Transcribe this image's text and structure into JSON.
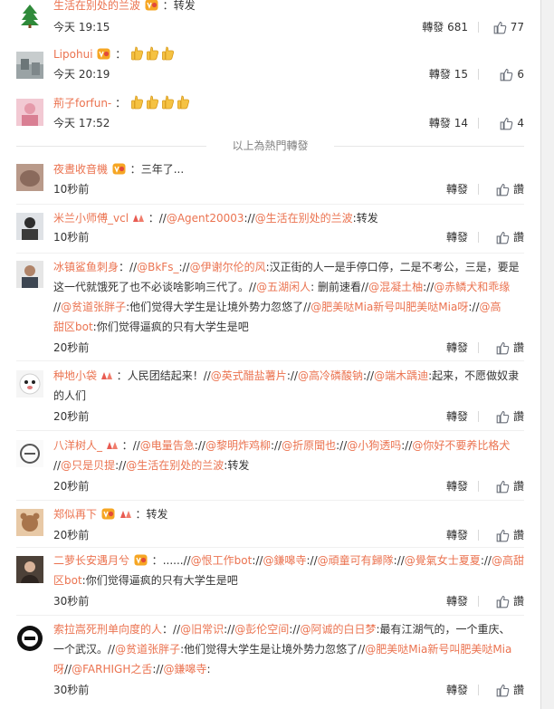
{
  "texts": {
    "popular_divider": "以上為熱門轉發",
    "retweet_label": "轉發",
    "like_label": "讚",
    "colon": "："
  },
  "colors": {
    "accent": "#eb7350",
    "text": "#333333",
    "muted": "#808080"
  },
  "icons": [
    "vip-badge-icon",
    "candle-flag-icon",
    "thumbs-up-emoji-icon",
    "like-icon"
  ],
  "popular": [
    {
      "name": "生活在别处的兰波",
      "text": "转发",
      "time": "今天 19:15",
      "retweets": "轉發 681",
      "likes": "77"
    },
    {
      "name": "Lipohui",
      "text": "",
      "thumbs": 3,
      "time": "今天 20:19",
      "retweets": "轉發 15",
      "likes": "6"
    },
    {
      "name": "荊子forfun-",
      "text": "",
      "thumbs": 4,
      "time": "今天 17:52",
      "retweets": "轉發 14",
      "likes": "4"
    }
  ],
  "recent": [
    {
      "name": "夜晝收音機",
      "line1": "三年了...",
      "time": "10秒前"
    },
    {
      "name": "米兰小师傅_vcl",
      "mentions": [
        "@Agent20003",
        "@生活在别处的兰波"
      ],
      "tail": "转发",
      "time": "10秒前"
    },
    {
      "name": "冰镇鲨鱼刺身",
      "m1": "@BkFs_",
      "m2": "@伊谢尔伦的风",
      "t2": "汉正街的人一是手停口停，二是不考公，三是，要是",
      "t3": "这一代就饿死了也不必谈啥影响三代了。",
      "m3": "@五湖闲人",
      "t4": "删前速看",
      "m4": "@混凝土柚",
      "m5": "@赤鳞犬和乖缘",
      "m6": "@贫道张胖子",
      "t6": "他们觉得大学生是让境外势力忽悠了",
      "m7": "@肥美哒Mia新号叫肥美哒Mia呀",
      "m8": "@高",
      "m9": "甜区bot",
      "t9": "你们觉得逼疯的只有大学生是吧",
      "time": "20秒前"
    },
    {
      "name": "种地小袋",
      "t1": "人民团结起来！",
      "m1": "@英式醋盐薯片",
      "m2": "@高冷磷酸钠",
      "m3": "@端木踽迪",
      "t2": "起来，不愿做奴隶",
      "t3": "的人们",
      "time": "20秒前"
    },
    {
      "name": "八洋树人_",
      "m1": "@电量告急",
      "m2": "@黎明炸鸡柳",
      "m3": "@折原聞也",
      "m4": "@小狗透吗",
      "m5": "@你好不要养比格犬",
      "m6": "@只是贝提",
      "m7": "@生活在别处的兰波",
      "tail": "转发",
      "time": "20秒前"
    },
    {
      "name": "郑似再下",
      "text": "转发",
      "time": "20秒前"
    },
    {
      "name": "二萝长安遇月兮",
      "t1": "......",
      "m1": "@恨工作bot",
      "m2": "@鎌嗥寺",
      "m3": "@頑童可有歸隊",
      "m4": "@覺氣女士夏夏",
      "m5": "@高甜",
      "m6": "区bot",
      "t6": "你们觉得逼疯的只有大学生是吧",
      "time": "30秒前"
    },
    {
      "name": "索拉嵩死刑单向度的人",
      "m1": "@旧常识",
      "m2": "@彭伦空间",
      "m3": "@阿诚的白日梦",
      "t3": "最有江湖气的，一个重庆、",
      "t4": "一个武汉。",
      "m4": "@贫道张胖子",
      "t5": "他们觉得大学生是让境外势力忽悠了",
      "m5": "@肥美哒Mia新号叫肥美哒Mia",
      "m6": "呀",
      "m7": "@FARHIGH之舌",
      "m8": "@鎌嗥寺",
      "t8": "",
      "time": "30秒前"
    }
  ]
}
